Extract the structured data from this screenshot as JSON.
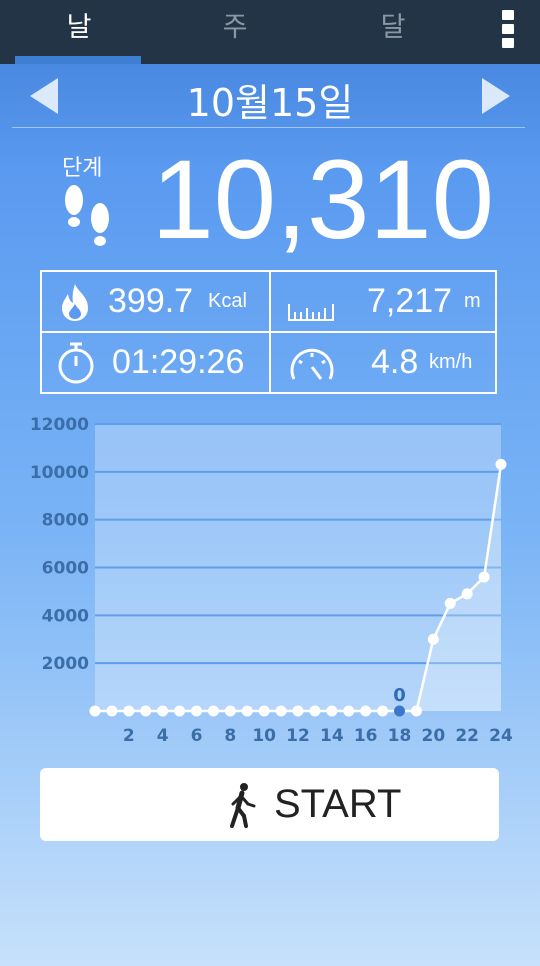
{
  "tabs": [
    {
      "label": "날",
      "active": true
    },
    {
      "label": "주",
      "active": false
    },
    {
      "label": "달",
      "active": false
    }
  ],
  "menu_icon": "more-vertical-icon",
  "date": "10월15일",
  "steps": {
    "label": "단계",
    "value": "10,310",
    "icon": "footprints-icon"
  },
  "stats": {
    "calories": {
      "value": "399.7",
      "unit": "Kcal",
      "icon": "flame-icon"
    },
    "distance": {
      "value": "7,217",
      "unit": "m",
      "icon": "ruler-icon"
    },
    "duration": {
      "value": "01:29:26",
      "icon": "stopwatch-icon"
    },
    "speed": {
      "value": "4.8",
      "unit": "km/h",
      "icon": "speedometer-icon"
    }
  },
  "chart_data": {
    "type": "line",
    "x": [
      0,
      1,
      2,
      3,
      4,
      5,
      6,
      7,
      8,
      9,
      10,
      11,
      12,
      13,
      14,
      15,
      16,
      17,
      18,
      19,
      20,
      21,
      22,
      23,
      24
    ],
    "values": [
      0,
      0,
      0,
      0,
      0,
      0,
      0,
      0,
      0,
      0,
      0,
      0,
      0,
      0,
      0,
      0,
      0,
      0,
      0,
      0,
      3000,
      4500,
      4900,
      5600,
      10310
    ],
    "xticks": [
      "2",
      "4",
      "6",
      "8",
      "10",
      "12",
      "14",
      "16",
      "18",
      "20",
      "22",
      "24"
    ],
    "yticks": [
      "2000",
      "4000",
      "6000",
      "8000",
      "10000",
      "12000"
    ],
    "ylim": [
      0,
      12000
    ],
    "xlim": [
      0,
      24
    ],
    "highlight": {
      "x": 18,
      "label": "0"
    },
    "grid": true
  },
  "start_button": {
    "label": "START",
    "icon": "walking-person-icon"
  }
}
